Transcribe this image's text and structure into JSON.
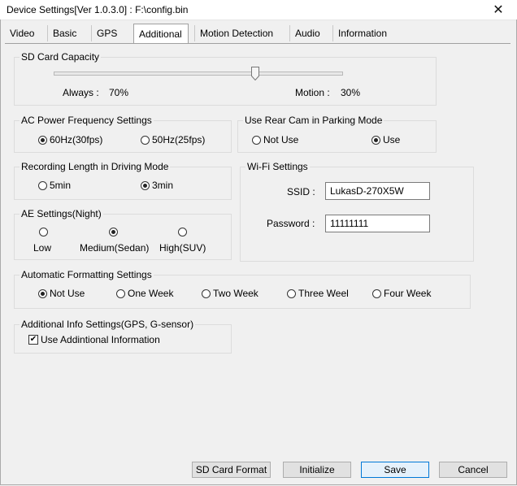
{
  "window": {
    "title": "Device Settings[Ver 1.0.3.0] : F:\\config.bin",
    "close_glyph": "✕"
  },
  "tabs": [
    {
      "label": "Video"
    },
    {
      "label": "Basic"
    },
    {
      "label": "GPS"
    },
    {
      "label": "Additional",
      "active": true
    },
    {
      "label": "Motion Detection"
    },
    {
      "label": "Audio"
    },
    {
      "label": "Information"
    }
  ],
  "sd_card": {
    "title": "SD Card Capacity",
    "always_label": "Always :",
    "always_value": "70%",
    "motion_label": "Motion :",
    "motion_value": "30%",
    "slider_fraction": 0.7
  },
  "ac_power": {
    "title": "AC Power Frequency Settings",
    "options": [
      "60Hz(30fps)",
      "50Hz(25fps)"
    ],
    "selected": "60Hz(30fps)"
  },
  "rear_cam": {
    "title": "Use Rear Cam in Parking Mode",
    "options": [
      "Not Use",
      "Use"
    ],
    "selected": "Use"
  },
  "recording": {
    "title": "Recording Length in Driving Mode",
    "options": [
      "5min",
      "3min"
    ],
    "selected": "3min"
  },
  "wifi": {
    "title": "Wi-Fi Settings",
    "ssid_label": "SSID :",
    "ssid_value": "LukasD-270X5W",
    "password_label": "Password :",
    "password_value": "11111111"
  },
  "ae": {
    "title": "AE Settings(Night)",
    "options": [
      "Low",
      "Medium(Sedan)",
      "High(SUV)"
    ],
    "selected": "Medium(Sedan)"
  },
  "auto_format": {
    "title": "Automatic Formatting Settings",
    "options": [
      "Not Use",
      "One Week",
      "Two Week",
      "Three Weel",
      "Four Week"
    ],
    "selected": "Not Use"
  },
  "additional_info": {
    "title": "Additional Info Settings(GPS, G-sensor)",
    "checkbox_label": "Use Addintional Information",
    "checked": true
  },
  "buttons": {
    "sd_format": "SD Card Format",
    "initialize": "Initialize",
    "save": "Save",
    "cancel": "Cancel"
  }
}
